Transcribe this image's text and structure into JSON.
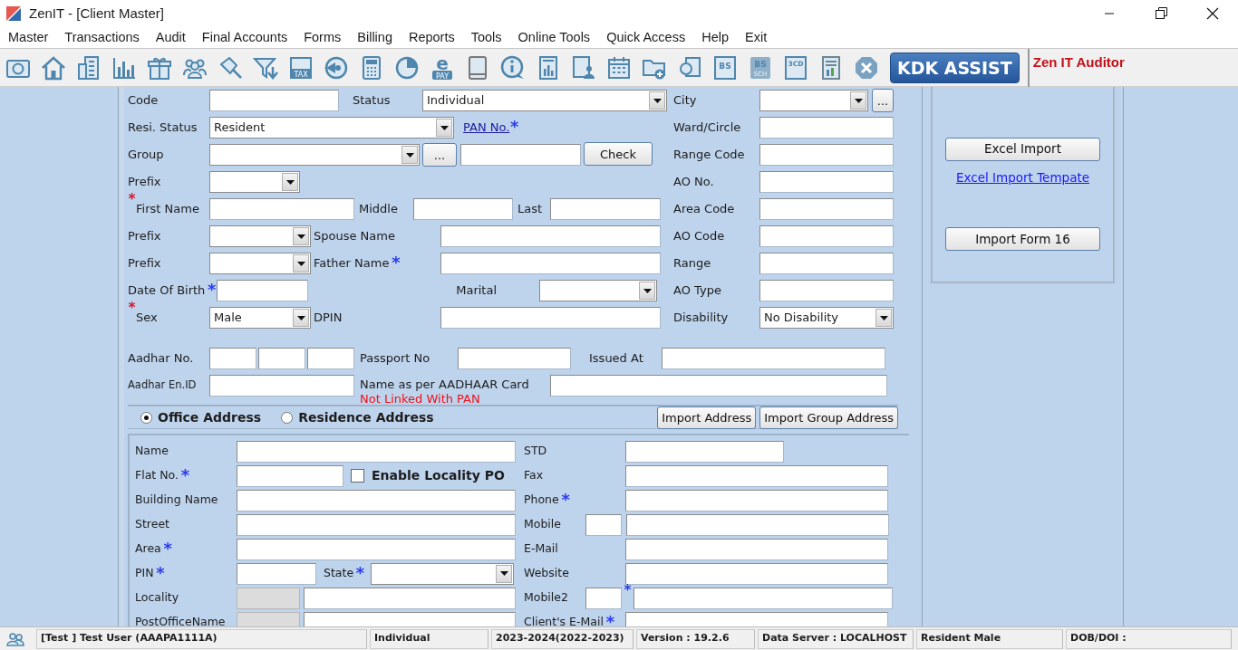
{
  "window": {
    "title": "ZenIT - [Client Master]"
  },
  "menu": [
    "Master",
    "Transactions",
    "Audit",
    "Final Accounts",
    "Forms",
    "Billing",
    "Reports",
    "Tools",
    "Online Tools",
    "Quick Access",
    "Help",
    "Exit"
  ],
  "toolbar": {
    "icons": [
      {
        "kind": "rupee"
      },
      {
        "kind": "home"
      },
      {
        "kind": "building"
      },
      {
        "kind": "bars"
      },
      {
        "kind": "gift"
      },
      {
        "kind": "people"
      },
      {
        "kind": "pin"
      },
      {
        "kind": "filter"
      },
      {
        "kind": "tax",
        "text": "TAX"
      },
      {
        "kind": "disc"
      },
      {
        "kind": "calculator"
      },
      {
        "kind": "pie"
      },
      {
        "kind": "epay",
        "text": "e",
        "subtext": "PAY"
      },
      {
        "kind": "book"
      },
      {
        "kind": "info"
      },
      {
        "kind": "report"
      },
      {
        "kind": "persondoc"
      },
      {
        "kind": "calendar"
      },
      {
        "kind": "folderplus"
      },
      {
        "kind": "shapes"
      },
      {
        "kind": "bs",
        "text": "BS"
      },
      {
        "kind": "bssch",
        "text": "BS",
        "subtext": "SCH"
      },
      {
        "kind": "cd",
        "text": "3CD"
      },
      {
        "kind": "docchart"
      },
      {
        "kind": "close"
      }
    ],
    "assist_button": "KDK ASSIST",
    "product_name": "Zen IT Auditor"
  },
  "personal": [
    [
      {
        "kind": "label",
        "text": "Code"
      },
      {
        "kind": "input"
      },
      {
        "kind": "label",
        "text": "Status"
      },
      {
        "kind": "select",
        "value": "Individual"
      }
    ],
    [
      {
        "kind": "label",
        "text": "Resi. Status"
      },
      {
        "kind": "select",
        "value": "Resident"
      },
      {
        "kind": "link",
        "text": "PAN No.",
        "star": {
          "text": "*",
          "color": "#2b3cf0",
          "before": false
        }
      }
    ],
    [
      {
        "kind": "label",
        "text": "Group"
      },
      {
        "kind": "select"
      },
      {
        "kind": "browse",
        "text": "..."
      },
      {
        "kind": "input"
      },
      {
        "kind": "button",
        "text": "Check"
      }
    ],
    [
      {
        "kind": "label",
        "text": "Prefix"
      },
      {
        "kind": "select"
      }
    ],
    [
      {
        "kind": "label",
        "text": "First Name",
        "star": {
          "text": "*",
          "color": "#e0102a",
          "before": true
        }
      },
      {
        "kind": "input"
      },
      {
        "kind": "label",
        "text": "Middle"
      },
      {
        "kind": "input"
      },
      {
        "kind": "label",
        "text": "Last"
      },
      {
        "kind": "input"
      }
    ],
    [
      {
        "kind": "label",
        "text": "Prefix"
      },
      {
        "kind": "select"
      },
      {
        "kind": "label",
        "text": "Spouse Name"
      },
      {
        "kind": "input"
      }
    ],
    [
      {
        "kind": "label",
        "text": "Prefix"
      },
      {
        "kind": "select"
      },
      {
        "kind": "label",
        "text": "Father Name",
        "star": {
          "text": "*",
          "color": "#2b3cf0",
          "before": false
        }
      },
      {
        "kind": "input"
      }
    ],
    [
      {
        "kind": "label",
        "text": "Date Of Birth",
        "star": {
          "text": "*",
          "color": "#2b3cf0",
          "before": false
        }
      },
      {
        "kind": "input"
      },
      {
        "kind": "label",
        "text": "Marital"
      },
      {
        "kind": "select"
      }
    ],
    [
      {
        "kind": "label",
        "text": "Sex",
        "star": {
          "text": "*",
          "color": "#e0102a",
          "before": true
        }
      },
      {
        "kind": "select",
        "value": "Male"
      },
      {
        "kind": "label",
        "text": "DPIN"
      },
      {
        "kind": "input"
      }
    ]
  ],
  "tax_office": [
    [
      {
        "kind": "label",
        "text": "City"
      },
      {
        "kind": "select"
      },
      {
        "kind": "browse",
        "text": "..."
      }
    ],
    [
      {
        "kind": "label",
        "text": "Ward/Circle"
      },
      {
        "kind": "input"
      }
    ],
    [
      {
        "kind": "label",
        "text": "Range Code"
      },
      {
        "kind": "input"
      }
    ],
    [
      {
        "kind": "label",
        "text": "AO No."
      },
      {
        "kind": "input"
      }
    ],
    [
      {
        "kind": "label",
        "text": "Area Code"
      },
      {
        "kind": "input"
      }
    ],
    [
      {
        "kind": "label",
        "text": "AO Code"
      },
      {
        "kind": "input"
      }
    ],
    [
      {
        "kind": "label",
        "text": "Range"
      },
      {
        "kind": "input"
      }
    ],
    [
      {
        "kind": "label",
        "text": "AO Type"
      },
      {
        "kind": "input"
      }
    ],
    [
      {
        "kind": "label",
        "text": "Disability"
      },
      {
        "kind": "select",
        "value": "No Disability"
      }
    ]
  ],
  "identity": [
    [
      {
        "kind": "label",
        "text": "Aadhar No."
      },
      {
        "kind": "input"
      },
      {
        "kind": "input"
      },
      {
        "kind": "input"
      },
      {
        "kind": "label",
        "text": "Passport No"
      },
      {
        "kind": "input"
      },
      {
        "kind": "label",
        "text": "Issued At"
      },
      {
        "kind": "input"
      }
    ],
    [
      {
        "kind": "label",
        "text": "Aadhar En.ID"
      },
      {
        "kind": "input"
      },
      {
        "kind": "label_note",
        "text": "Name as per AADHAAR Card",
        "note": "Not Linked With PAN"
      },
      {
        "kind": "input"
      }
    ]
  ],
  "address_types": [
    {
      "label": "Office Address",
      "selected": true
    },
    {
      "label": "Residence Address",
      "selected": false
    }
  ],
  "address_buttons": [
    "Import Address",
    "Import Group Address"
  ],
  "address_left": [
    [
      {
        "kind": "label",
        "text": "Name"
      },
      {
        "kind": "input"
      }
    ],
    [
      {
        "kind": "label",
        "text": "Flat No.",
        "star": {
          "text": "*",
          "color": "#2b3cf0",
          "before": false
        }
      },
      {
        "kind": "input"
      },
      {
        "kind": "checkbox",
        "text": "Enable Locality PO",
        "checked": false
      }
    ],
    [
      {
        "kind": "label",
        "text": "Building Name"
      },
      {
        "kind": "input"
      }
    ],
    [
      {
        "kind": "label",
        "text": "Street"
      },
      {
        "kind": "input"
      }
    ],
    [
      {
        "kind": "label",
        "text": "Area",
        "star": {
          "text": "*",
          "color": "#2b3cf0",
          "before": false
        }
      },
      {
        "kind": "input"
      }
    ],
    [
      {
        "kind": "label",
        "text": "PIN",
        "star": {
          "text": "*",
          "color": "#2b3cf0",
          "before": false
        }
      },
      {
        "kind": "input"
      },
      {
        "kind": "label",
        "text": "State",
        "star": {
          "text": "*",
          "color": "#2b3cf0",
          "before": false
        }
      },
      {
        "kind": "select"
      }
    ],
    [
      {
        "kind": "label",
        "text": "Locality"
      },
      {
        "kind": "input",
        "disabled": true
      },
      {
        "kind": "input",
        "disabled": false
      }
    ],
    [
      {
        "kind": "label",
        "text": "PostOfficeName"
      },
      {
        "kind": "input",
        "disabled": true
      },
      {
        "kind": "input",
        "disabled": false
      }
    ]
  ],
  "address_right": [
    [
      {
        "kind": "label",
        "text": "STD"
      },
      {
        "kind": "input"
      }
    ],
    [
      {
        "kind": "label",
        "text": "Fax"
      },
      {
        "kind": "input"
      }
    ],
    [
      {
        "kind": "label",
        "text": "Phone",
        "star": {
          "text": "*",
          "color": "#2b3cf0",
          "before": false
        }
      },
      {
        "kind": "input"
      }
    ],
    [
      {
        "kind": "label",
        "text": "Mobile"
      },
      {
        "kind": "input"
      },
      {
        "kind": "input"
      }
    ],
    [
      {
        "kind": "label",
        "text": "E-Mail"
      },
      {
        "kind": "input"
      }
    ],
    [
      {
        "kind": "label",
        "text": "Website"
      },
      {
        "kind": "input"
      }
    ],
    [
      {
        "kind": "label",
        "text": "Mobile2"
      },
      {
        "kind": "input"
      },
      {
        "kind": "star",
        "text": "*",
        "color": "#2b3cf0"
      },
      {
        "kind": "input"
      }
    ],
    [
      {
        "kind": "label",
        "text": "Client's E-Mail",
        "star": {
          "text": "*",
          "color": "#2b3cf0",
          "before": false
        }
      },
      {
        "kind": "input"
      }
    ]
  ],
  "import_panel": {
    "excel_button": "Excel Import",
    "template_link": "Excel Import Tempate",
    "form16_button": "Import Form 16"
  },
  "status_bar": [
    "[Test ] Test User (AAAPA1111A)",
    "Individual",
    "2023-2024(2022-2023)",
    "Version : 19.2.6",
    "Data Server : LOCALHOST",
    "Resident Male",
    "DOB/DOI :"
  ]
}
